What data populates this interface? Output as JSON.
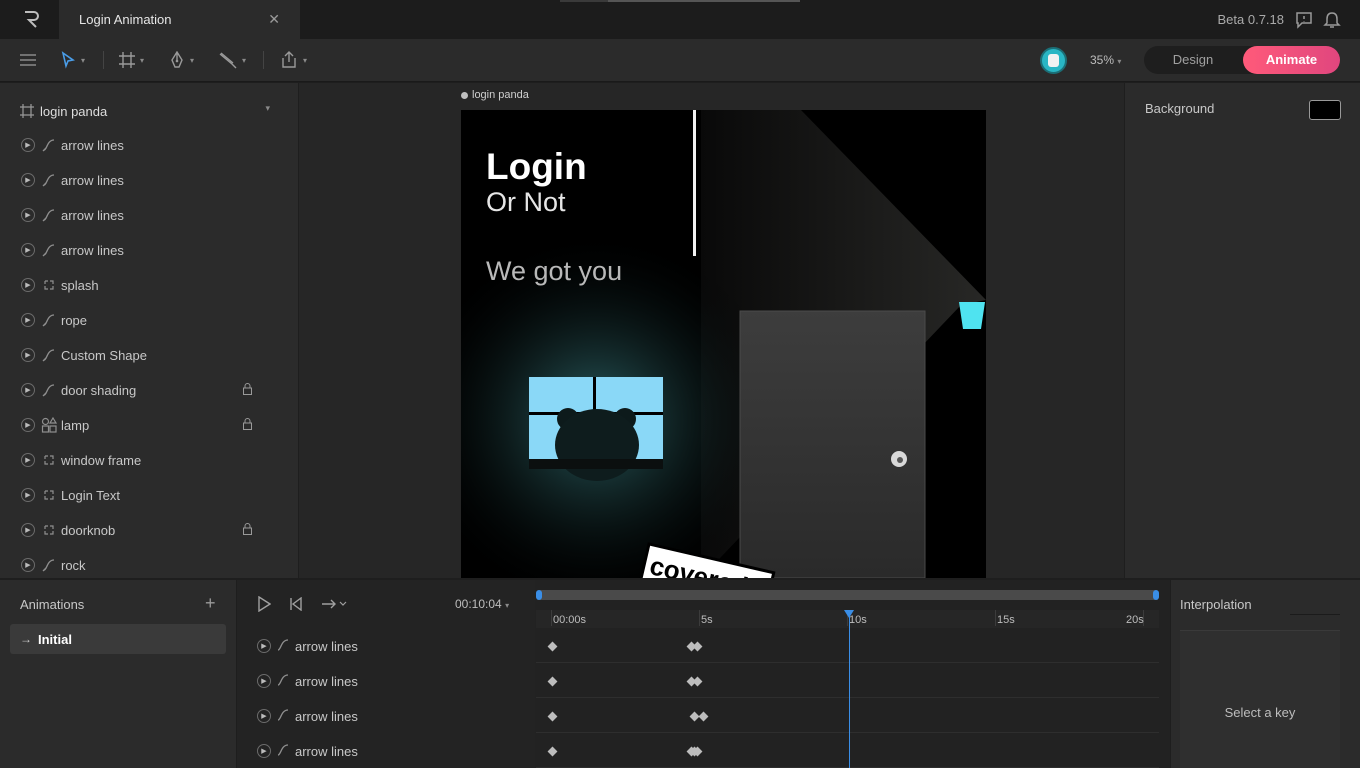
{
  "app": {
    "tab_title": "Login Animation",
    "tab_close": "✕",
    "version": "Beta 0.7.18"
  },
  "toolbar": {
    "zoom": "35%",
    "mode_design": "Design",
    "mode_animate": "Animate",
    "caret": "▾"
  },
  "hierarchy": {
    "artboard": "login panda",
    "layers": [
      {
        "name": "arrow lines",
        "type": "path",
        "locked": false
      },
      {
        "name": "arrow lines",
        "type": "path",
        "locked": false
      },
      {
        "name": "arrow lines",
        "type": "path",
        "locked": false
      },
      {
        "name": "arrow lines",
        "type": "path",
        "locked": false
      },
      {
        "name": "splash",
        "type": "group",
        "locked": false
      },
      {
        "name": "rope",
        "type": "path",
        "locked": false
      },
      {
        "name": "Custom Shape",
        "type": "path",
        "locked": false
      },
      {
        "name": "door shading",
        "type": "path",
        "locked": true
      },
      {
        "name": "lamp",
        "type": "shapes",
        "locked": true
      },
      {
        "name": "window frame",
        "type": "group",
        "locked": false
      },
      {
        "name": "Login Text",
        "type": "group",
        "locked": false
      },
      {
        "name": "doorknob",
        "type": "group",
        "locked": true
      },
      {
        "name": "rock",
        "type": "path",
        "locked": false
      }
    ]
  },
  "canvas": {
    "artboard_label": "login panda",
    "login_title": "Login",
    "login_subtitle": "Or Not",
    "tagline": "We got you",
    "stamp": "covered !!",
    "colors": {
      "window": "#8ad8f7",
      "lamp": "#4fe3f0",
      "door": "#3a3a3a"
    }
  },
  "inspector": {
    "background_label": "Background",
    "background_color": "#000000"
  },
  "animations": {
    "title": "Animations",
    "add_label": "+",
    "items": [
      {
        "name": "Initial",
        "icon": "→"
      }
    ]
  },
  "timeline": {
    "current_time": "00:10:04",
    "ticks": [
      "00:00s",
      "5s",
      "10s",
      "15s",
      "20s"
    ],
    "rows": [
      {
        "name": "arrow lines",
        "keys_at_s": [
          0,
          4.7,
          4.9
        ]
      },
      {
        "name": "arrow lines",
        "keys_at_s": [
          0,
          4.7,
          4.9
        ]
      },
      {
        "name": "arrow lines",
        "keys_at_s": [
          0,
          4.8,
          5.1
        ]
      },
      {
        "name": "arrow lines",
        "keys_at_s": [
          0,
          4.7,
          4.8,
          4.9
        ]
      }
    ],
    "playhead_s": 10.04,
    "duration_s": 20
  },
  "interpolation": {
    "title": "Interpolation",
    "hint": "Select a key"
  }
}
